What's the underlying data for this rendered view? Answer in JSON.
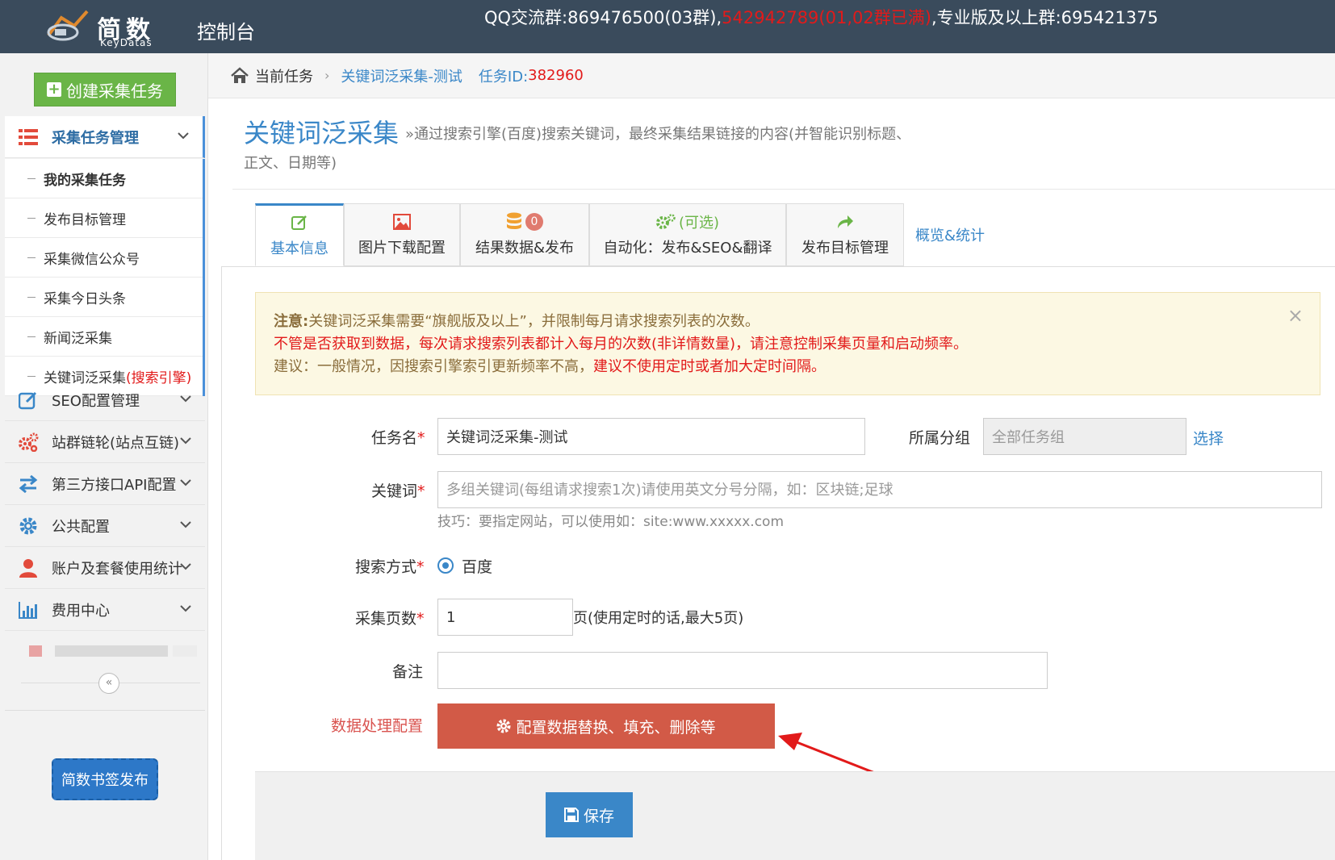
{
  "topbar": {
    "logo_name": "简数",
    "logo_sub": "KeyDatas",
    "console": "控制台",
    "qq_prefix": "QQ交流群:869476500(03群),",
    "qq_red": "542942789(01,02群已满)",
    "qq_suffix": ",专业版及以上群:695421375"
  },
  "sidebar": {
    "create_button": "创建采集任务",
    "task_mgmt": "采集任务管理",
    "sub_items": [
      {
        "label": "我的采集任务"
      },
      {
        "label": "发布目标管理"
      },
      {
        "label": "采集微信公众号"
      },
      {
        "label": "采集今日头条"
      },
      {
        "label": "新闻泛采集"
      },
      {
        "label": "关键词泛采集",
        "suffix": "(搜索引擎)"
      }
    ],
    "menus": [
      {
        "label": "SEO配置管理",
        "icon": "edit-icon"
      },
      {
        "label": "站群链轮(站点互链)",
        "icon": "gears-icon"
      },
      {
        "label": "第三方接口API配置",
        "icon": "exchange-icon"
      },
      {
        "label": "公共配置",
        "icon": "gear-icon"
      },
      {
        "label": "账户及套餐使用统计",
        "icon": "user-icon"
      },
      {
        "label": "费用中心",
        "icon": "bar-chart-icon"
      }
    ],
    "collapse_symbol": "«",
    "bookmark_button": "简数书签发布"
  },
  "breadcrumb": {
    "current": "当前任务",
    "separator": "›",
    "task_name": "关键词泛采集-测试",
    "task_id_label": "任务ID:",
    "task_id": "382960"
  },
  "header": {
    "title": "关键词泛采集",
    "desc_line1": "»通过搜索引擎(百度)搜索关键词，最终采集结果链接的内容(并智能识别标题、",
    "desc_line2": "正文、日期等)"
  },
  "tabs": [
    {
      "label": "基本信息",
      "icon": "edit-icon"
    },
    {
      "label": "图片下载配置",
      "icon": "image-icon"
    },
    {
      "label": "结果数据&发布",
      "icon": "database-icon",
      "badge": "0"
    },
    {
      "label": "自动化：发布&SEO&翻译",
      "icon": "gears-icon",
      "icon_label": "(可选)"
    },
    {
      "label": "发布目标管理",
      "icon": "share-icon"
    }
  ],
  "tab_link": "概览&统计",
  "alert": {
    "l1_bold": "注意:",
    "l1": "关键词泛采集需要“旗舰版及以上”，并限制每月请求搜索列表的次数。",
    "l2": "不管是否获取到数据，每次请求搜索列表都计入每月的次数(非详情数量)，请注意控制采集页量和启动频率。",
    "l3": "建议：一般情况，因搜索引擎索引更新频率不高，",
    "l3_red": "建议不使用定时或者加大定时间隔。",
    "close": "×"
  },
  "form": {
    "task_name_label": "任务名",
    "task_name_value": "关键词泛采集-测试",
    "group_label": "所属分组",
    "group_value": "全部任务组",
    "select_link": "选择",
    "keyword_label": "关键词",
    "keyword_placeholder": "多组关键词(每组请求搜索1次)请使用英文分号分隔，如：区块链;足球",
    "keyword_hint": "技巧：要指定网站，可以使用如：site:www.xxxxx.com",
    "search_label": "搜索方式",
    "search_option": "百度",
    "pages_label": "采集页数",
    "pages_value": "1",
    "pages_suffix": "页(使用定时的话,最大5页)",
    "remark_label": "备注",
    "remark_value": "",
    "required_mark": "*",
    "data_proc_label": "数据处理配置",
    "data_proc_button": "配置数据替换、填充、删除等",
    "save_button": "保存"
  },
  "colors": {
    "topbar": "#3a4b5c",
    "accent_blue": "#3a87c8",
    "green": "#6ab547",
    "red": "#e21a1a",
    "data_btn": "#d25a47"
  }
}
